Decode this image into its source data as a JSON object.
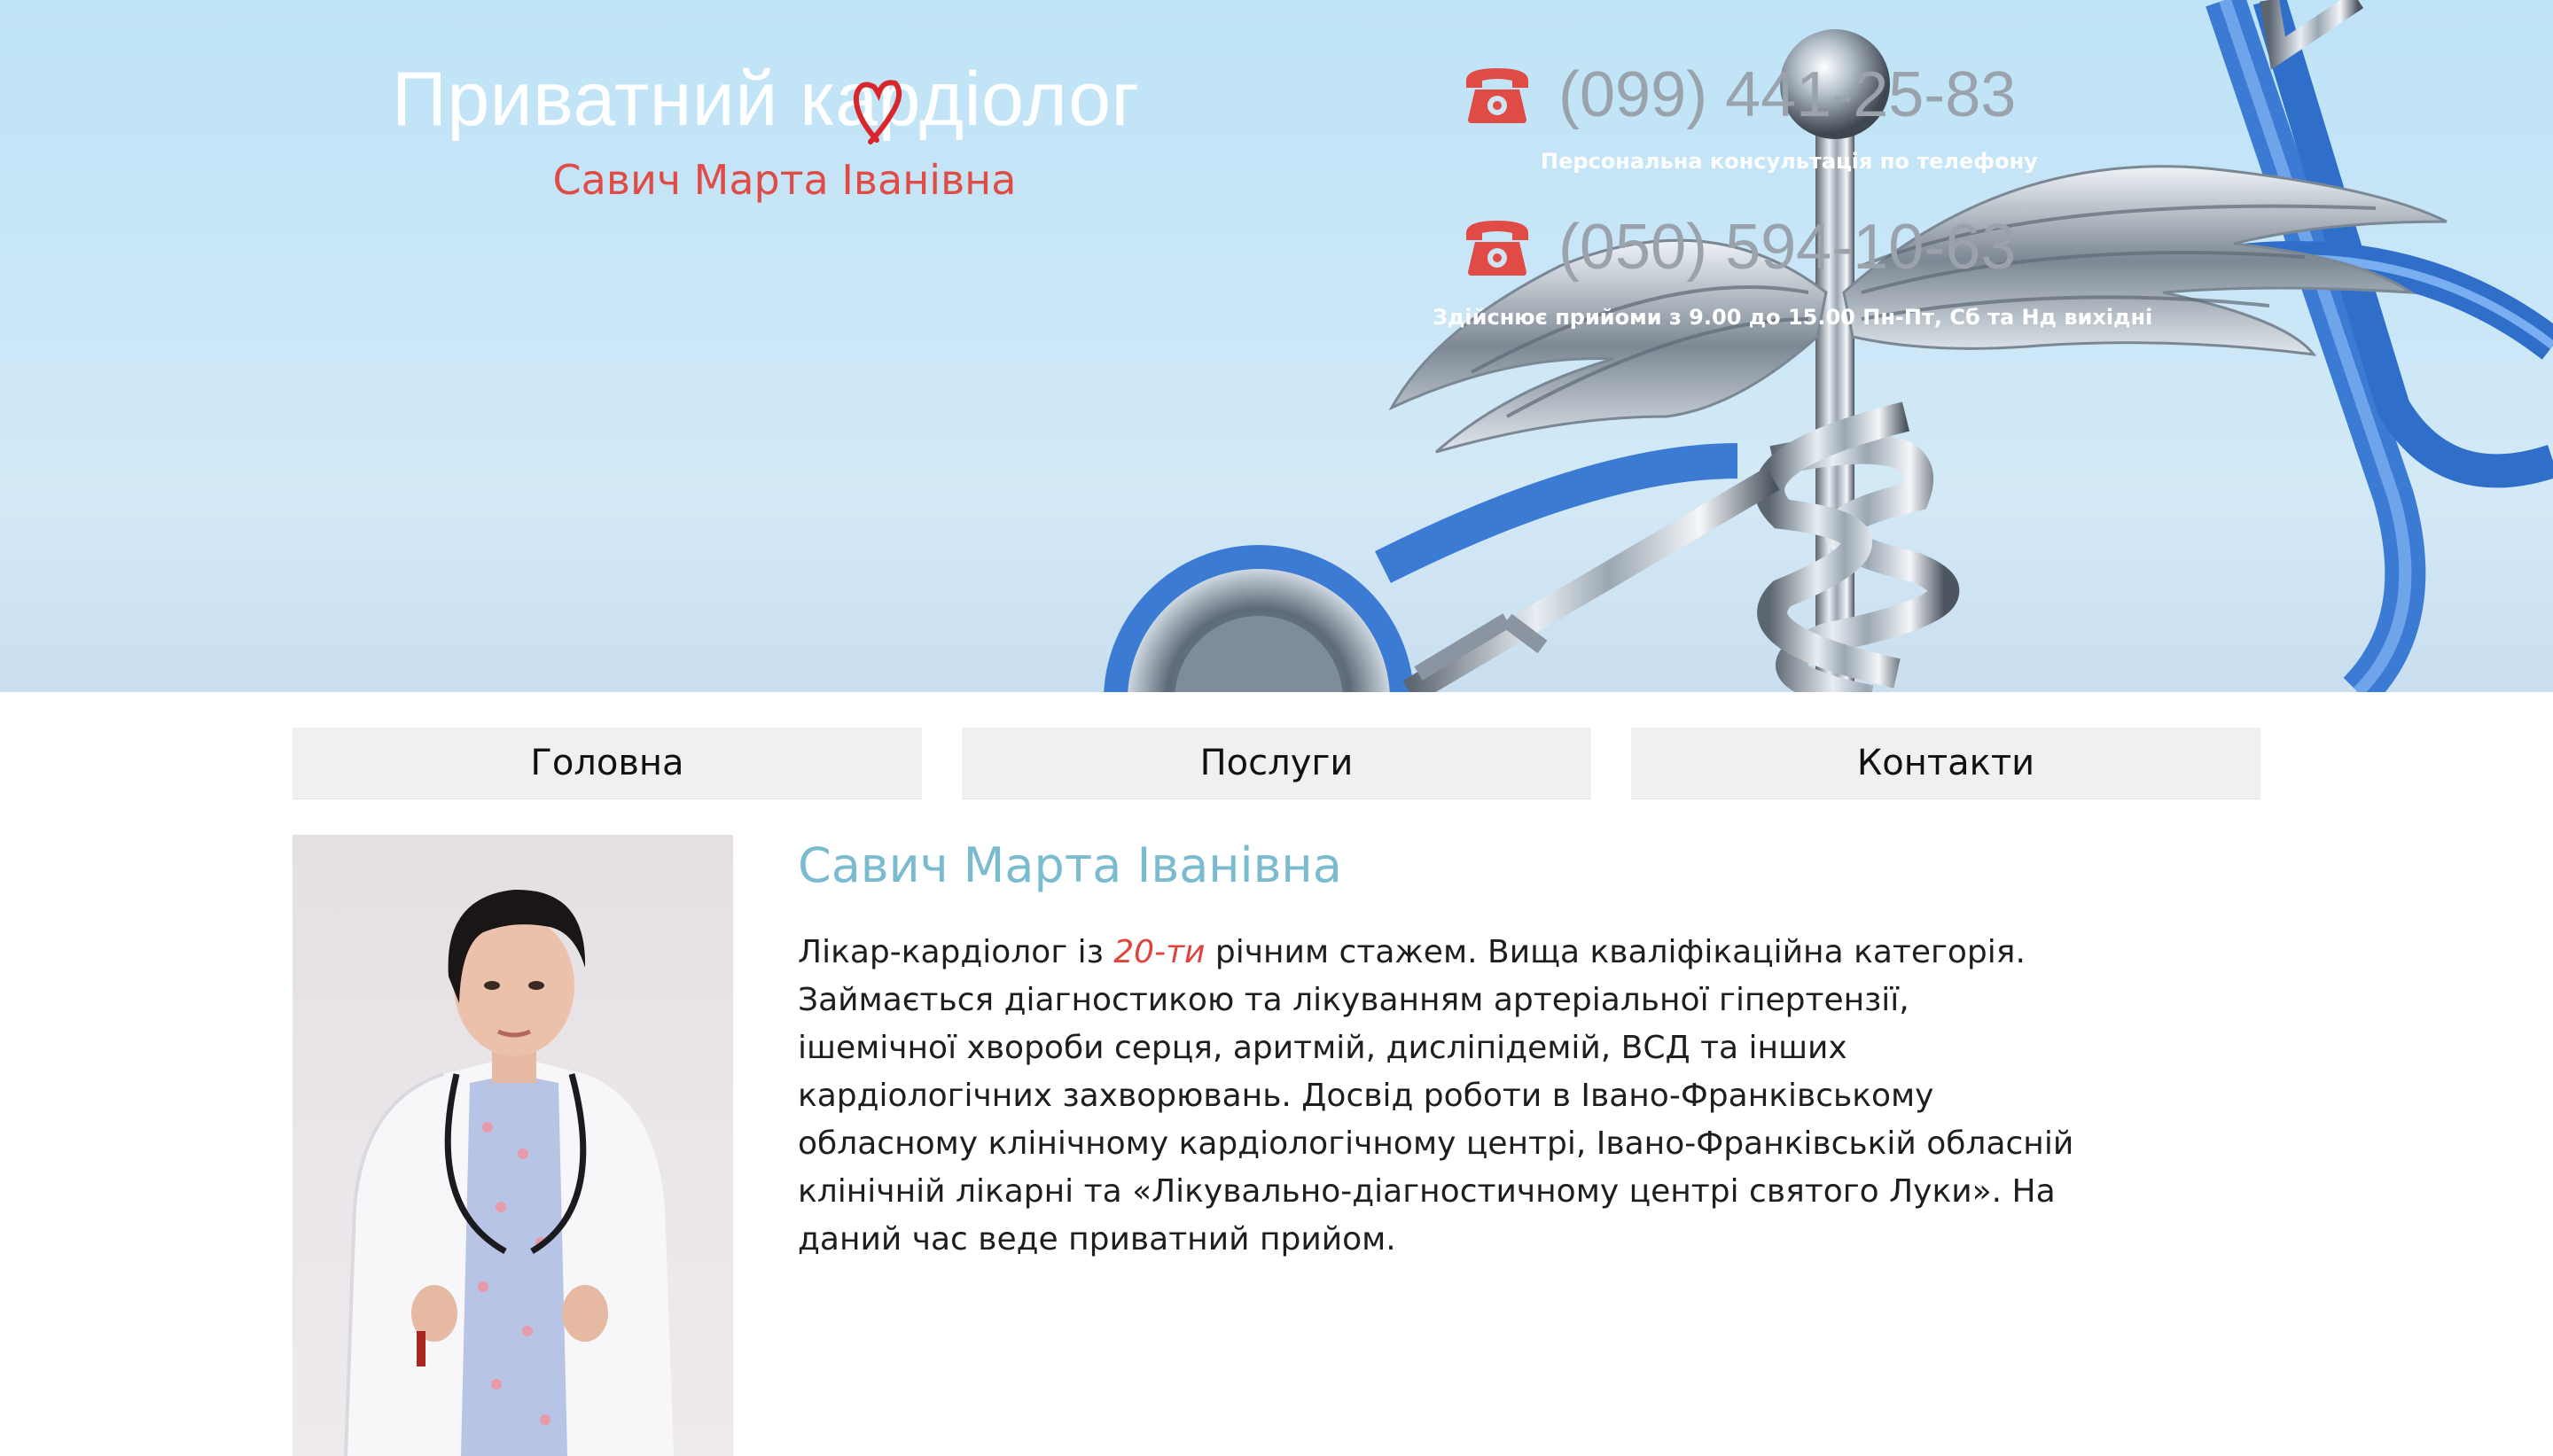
{
  "header": {
    "title": "Приватний кардіолог",
    "subtitle": "Савич Марта Іванівна",
    "phones": [
      {
        "number": "(099) 441-25-83",
        "note": "Персональна консультація по телефону",
        "icon": "telephone-icon"
      },
      {
        "number": "(050) 594-10-63",
        "note": "Здійснює прийоми з 9.00 до 15.00 Пн-Пт, Сб та Нд вихідні",
        "icon": "telephone-icon"
      }
    ],
    "background": "caduceus-stethoscope-image"
  },
  "nav": {
    "items": [
      {
        "label": "Головна"
      },
      {
        "label": "Послуги"
      },
      {
        "label": "Контакти"
      }
    ]
  },
  "main": {
    "photo": "doctor-portrait",
    "name": "Савич Марта Іванівна",
    "bio": {
      "before": "Лікар-кардіолог із ",
      "highlight": "20-ти",
      "after": " річним стажем. Вища кваліфікаційна категорія. Займається діагностикою та лікуванням артеріальної гіпертензії, ішемічної хвороби серця, аритмій, дисліпідемій, ВСД та інших кардіологічних захворювань. Досвід роботи в Івано-Франківському обласному клінічному кардіологічному центрі, Івано-Франківській обласній клінічній лікарні та «Лікувально-діагностичному центрі святого Луки». На даний час веде приватний прийом."
    }
  },
  "colors": {
    "accent_red": "#e04b45",
    "name_blue": "#7bbbd0",
    "nav_bg": "#f0f0f0",
    "phone_gray": "#9aa3ab"
  }
}
